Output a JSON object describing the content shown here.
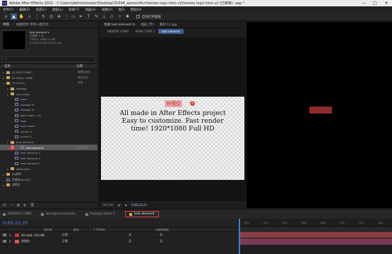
{
  "titlebar": {
    "app_title": "Adobe After Effects 2021 - C:\\Users\\Administrator\\Desktop\\31594_aemonificr\\heroes logo intro v2\\heroes logo intro v2 (已转换) .aep *",
    "icon": "Ae"
  },
  "menu": [
    "文件(F)",
    "编辑(E)",
    "合成(C)",
    "图层(L)",
    "效果(T)",
    "动画(A)",
    "视图(V)",
    "窗口",
    "帮助(H)"
  ],
  "toolbar": {
    "auto_open_label": "自动打开面板"
  },
  "project": {
    "tabs": [
      "项目",
      "效果控件 字体+提示文"
    ],
    "selected_name": "text element ▾",
    "selected_info": "已使用 1 次",
    "selected_res": "1920 x 1080 (1.00)",
    "selected_dur": "Δ 0;00;15;00, 29.97 fps",
    "col_name": "名称",
    "col_note": "注释",
    "tree": [
      {
        "label": "01 EDIT COMP",
        "note": "编辑此合成",
        "indent": 0,
        "type": "folder"
      },
      {
        "label": "02 FINAL COMP",
        "note": "最终合成",
        "indent": 0,
        "type": "folder"
      },
      {
        "label": "03 others",
        "note": "其他",
        "indent": 0,
        "type": "folder"
      },
      {
        "label": "footage",
        "note": "",
        "indent": 1,
        "type": "folder"
      },
      {
        "label": "pre_comp",
        "note": "",
        "indent": 1,
        "type": "folder"
      },
      {
        "label": "color",
        "note": "",
        "indent": 2,
        "type": "comp"
      },
      {
        "label": "footage fx",
        "note": "",
        "indent": 2,
        "type": "comp"
      },
      {
        "label": "footage fx",
        "note": "",
        "indent": 2,
        "type": "comp"
      },
      {
        "label": "light Leaks - 01",
        "note": "",
        "indent": 2,
        "type": "comp"
      },
      {
        "label": "logo",
        "note": "",
        "indent": 2,
        "type": "comp"
      },
      {
        "label": "logo mask",
        "note": "",
        "indent": 2,
        "type": "comp"
      },
      {
        "label": "screen 1",
        "note": "",
        "indent": 2,
        "type": "comp"
      },
      {
        "label": "screen 2",
        "note": "",
        "indent": 2,
        "type": "comp"
      },
      {
        "label": "text element",
        "note": "",
        "indent": 1,
        "type": "folder"
      },
      {
        "label": "text element",
        "note": "介绍文案",
        "indent": 2,
        "type": "comp",
        "selected": true,
        "step": "1"
      },
      {
        "label": "text element 2",
        "note": "",
        "indent": 2,
        "type": "comp"
      },
      {
        "label": "text element 3",
        "note": "",
        "indent": 2,
        "type": "comp"
      },
      {
        "label": "text element 4",
        "note": "",
        "indent": 2,
        "type": "comp"
      },
      {
        "label": "watercolor",
        "note": "",
        "indent": 1,
        "type": "folder"
      },
      {
        "label": "pig素材",
        "note": "",
        "indent": 0,
        "type": "folder"
      },
      {
        "label": "先随机bg.mp3",
        "note": "",
        "indent": 0,
        "type": "file"
      },
      {
        "label": "纯素材",
        "note": "",
        "indent": 0,
        "type": "folder"
      }
    ]
  },
  "viewer": {
    "tabs": [
      "合成 text element ≡",
      "图层 (无)",
      "素材 11.jpg"
    ],
    "crumbs": [
      "RENDER COMP",
      "MAIN COMP 2",
      "text element"
    ],
    "chinese_label": "孙悟空",
    "step": "2",
    "lines": [
      "All made in After Effects project",
      "Easy to customize. Fast render",
      "time! 1920*1080 Full HD"
    ],
    "zoom": "(24.3%)",
    "timecode": "0;00;22;25"
  },
  "timeline": {
    "tabs": [
      "RENDER COMP",
      "background photo",
      "footage alpha 2",
      "text element"
    ],
    "active_tab": "text element",
    "timecode": "0;00;22;25",
    "col_labels": [
      "源名称",
      "模式",
      "T TrkMat",
      "父级和链接"
    ],
    "layers": [
      {
        "num": "1",
        "name": "All mad...Full HD",
        "mode": "正常",
        "matte": "无",
        "parent": "无",
        "color": "#c33"
      },
      {
        "num": "2",
        "name": "孙悟空",
        "mode": "正常",
        "matte": "无",
        "parent": "无",
        "color": "#d55"
      }
    ],
    "ruler": [
      "00s",
      "02s",
      "04s",
      "06s",
      "08s",
      "10s",
      "12s",
      "14s"
    ]
  },
  "colors": {
    "accent": "#3a5e92",
    "step_badge": "#d8453f",
    "timecode": "#4a8ee0"
  }
}
